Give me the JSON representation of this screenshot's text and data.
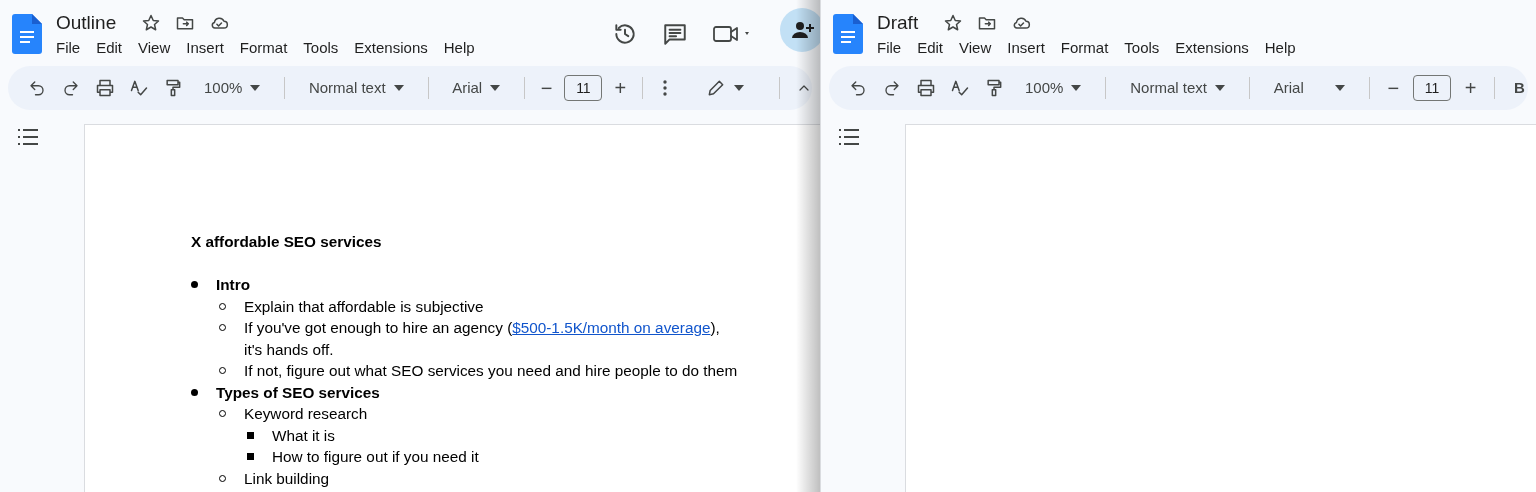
{
  "windows": [
    {
      "title": "Outline",
      "menu": [
        "File",
        "Edit",
        "View",
        "Insert",
        "Format",
        "Tools",
        "Extensions",
        "Help"
      ],
      "toolbar": {
        "zoom": "100%",
        "style": "Normal text",
        "font": "Arial",
        "size": "11",
        "minus": "−",
        "plus": "+"
      },
      "header_actions": true,
      "document": {
        "heading": "X affordable SEO services",
        "items": [
          {
            "text": "Intro",
            "bold": true,
            "children": [
              {
                "text": "Explain that affordable is subjective"
              },
              {
                "text": "If you've got enough to hire an agency (",
                "link": "$500-1.5K/month on average",
                "after": "),",
                "continuation": "it's hands off."
              },
              {
                "text": "If not, figure out what SEO services you need and hire people to do them"
              }
            ]
          },
          {
            "text": "Types of SEO services",
            "bold": true,
            "children": [
              {
                "text": "Keyword research",
                "children": [
                  {
                    "text": "What it is"
                  },
                  {
                    "text": "How to figure out if you need it"
                  }
                ]
              },
              {
                "text": "Link building"
              }
            ]
          }
        ]
      }
    },
    {
      "title": "Draft",
      "menu": [
        "File",
        "Edit",
        "View",
        "Insert",
        "Format",
        "Tools",
        "Extensions",
        "Help"
      ],
      "toolbar": {
        "zoom": "100%",
        "style": "Normal text",
        "font": "Arial",
        "size": "11",
        "minus": "−",
        "plus": "+",
        "bold": "B"
      },
      "header_actions": false
    }
  ]
}
